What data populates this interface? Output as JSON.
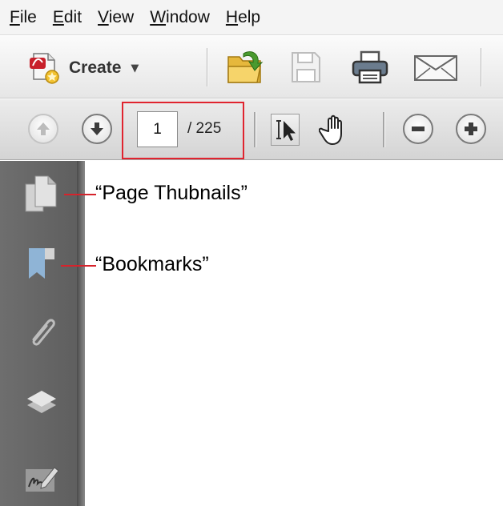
{
  "menu": [
    {
      "mnemonic": "F",
      "rest": "ile"
    },
    {
      "mnemonic": "E",
      "rest": "dit"
    },
    {
      "mnemonic": "V",
      "rest": "iew"
    },
    {
      "mnemonic": "W",
      "rest": "indow"
    },
    {
      "mnemonic": "H",
      "rest": "elp"
    }
  ],
  "toolbar": {
    "create_label": "Create",
    "icons": [
      "create-pdf-icon",
      "open-folder-icon",
      "save-disk-icon",
      "printer-icon",
      "email-envelope-icon"
    ]
  },
  "navigation": {
    "current_page": "1",
    "total_pages": "/ 225",
    "icons": [
      "previous-page-icon",
      "next-page-icon",
      "select-tool-icon",
      "hand-tool-icon",
      "zoom-out-icon",
      "zoom-in-icon"
    ]
  },
  "sidebar": {
    "icons": [
      "page-thumbnails-icon",
      "bookmarks-icon",
      "attachments-icon",
      "layers-icon",
      "signatures-icon"
    ]
  },
  "annotations": {
    "page_thumbnails": "“Page Thubnails”",
    "bookmarks": "“Bookmarks”"
  },
  "colors": {
    "highlight": "#e0242f",
    "sidebar": "#666666"
  }
}
